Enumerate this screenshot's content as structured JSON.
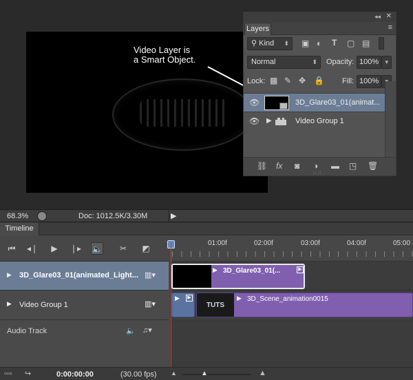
{
  "callout": {
    "line1": "Video Layer is",
    "line2": "a Smart Object."
  },
  "layers_panel": {
    "tab": "Layers",
    "filter_kind": "Kind",
    "blend_mode": "Normal",
    "opacity_label": "Opacity:",
    "opacity_value": "100%",
    "lock_label": "Lock:",
    "fill_label": "Fill:",
    "fill_value": "100%",
    "layers": [
      {
        "name": "3D_Glare03_01(animat...",
        "selected": true
      },
      {
        "name": "Video Group 1",
        "selected": false
      }
    ]
  },
  "statusbar": {
    "zoom": "68.3%",
    "doc": "Doc: 1012.5K/3.30M"
  },
  "timeline": {
    "tab": "Timeline",
    "ruler": [
      "01:00f",
      "02:00f",
      "03:00f",
      "04:00f",
      "05:00"
    ],
    "tracks": [
      {
        "name": "3D_Glare03_01(animated_Light...",
        "clip": "3D_Glare03_01(...",
        "selected": true
      },
      {
        "name": "Video Group 1",
        "clip": "3D_Scene_animation0015",
        "selected": false
      }
    ],
    "audio_track": "Audio Track",
    "thumb_text": "TUTS",
    "timecode": "0:00:00:00",
    "fps": "(30.00 fps)"
  }
}
